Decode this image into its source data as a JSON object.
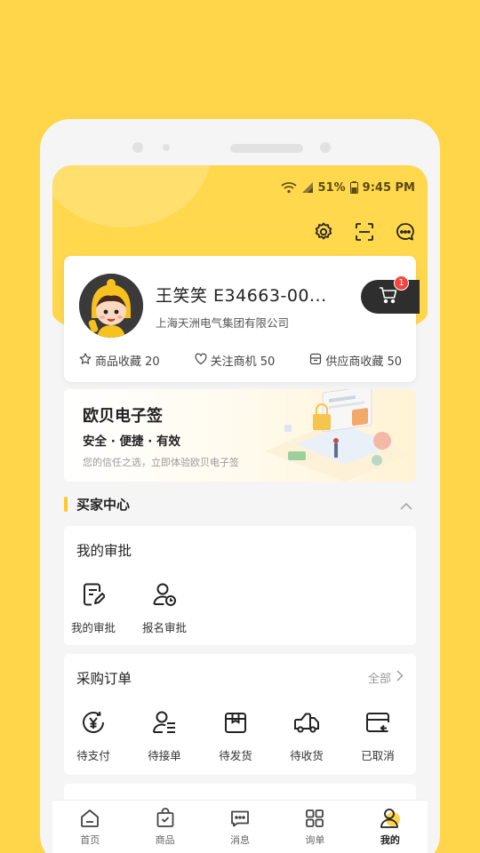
{
  "status_bar": {
    "battery": "51%",
    "time": "9:45 PM"
  },
  "header": {
    "icons": [
      "gear-icon",
      "scan-icon",
      "message-icon"
    ]
  },
  "profile": {
    "name": "王笑笑  E34663-00...",
    "company": "上海天洲电气集团有限公司",
    "cart_badge": "1",
    "stats": [
      {
        "label": "商品收藏 20",
        "icon": "star-icon"
      },
      {
        "label": "关注商机 50",
        "icon": "heart-icon"
      },
      {
        "label": "供应商收藏 50",
        "icon": "store-icon"
      }
    ]
  },
  "banner": {
    "title": "欧贝电子签",
    "subtitle": "安全 · 便捷 · 有效",
    "description": "您的信任之选，立即体验欧贝电子签"
  },
  "buyer_center": {
    "title": "买家中心"
  },
  "approval": {
    "title": "我的审批",
    "items": [
      {
        "label": "我的审批",
        "icon": "approval-doc-icon"
      },
      {
        "label": "报名审批",
        "icon": "user-clock-icon"
      }
    ]
  },
  "orders": {
    "title": "采购订单",
    "all_label": "全部",
    "items": [
      {
        "label": "待支付",
        "icon": "yuan-icon"
      },
      {
        "label": "待接单",
        "icon": "user-list-icon"
      },
      {
        "label": "待发货",
        "icon": "box-icon"
      },
      {
        "label": "待收货",
        "icon": "truck-icon"
      },
      {
        "label": "已取消",
        "icon": "cancel-icon"
      }
    ]
  },
  "tabbar": {
    "active_index": 4,
    "items": [
      {
        "label": "首页",
        "icon": "home-icon"
      },
      {
        "label": "商品",
        "icon": "bag-icon"
      },
      {
        "label": "消息",
        "icon": "chat-icon"
      },
      {
        "label": "询单",
        "icon": "grid-icon"
      },
      {
        "label": "我的",
        "icon": "profile-icon"
      }
    ]
  },
  "colors": {
    "brand_yellow": "#FFD54A",
    "accent": "#FFC931",
    "badge_red": "#F2463E",
    "dark": "#2E2E2E"
  }
}
